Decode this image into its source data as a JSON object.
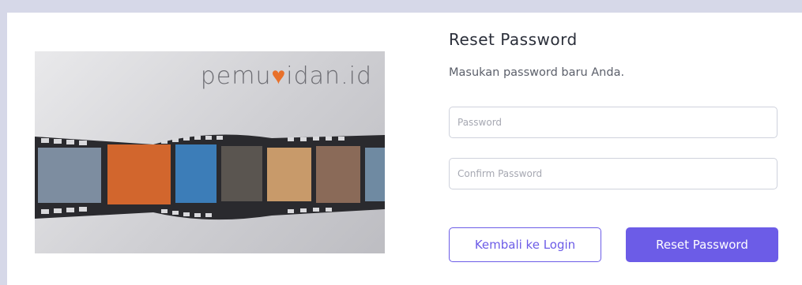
{
  "banner": {
    "logo_prefix": "pemu",
    "logo_heart": "♥",
    "logo_suffix": "idan.id"
  },
  "form": {
    "title": "Reset Password",
    "subtitle": "Masukan password baru Anda.",
    "password_placeholder": "Password",
    "confirm_placeholder": "Confirm Password",
    "back_label": "Kembali ke Login",
    "reset_label": "Reset Password"
  },
  "colors": {
    "accent": "#6c5ce7",
    "background": "#d6d8e8",
    "logo_accent": "#e8702a"
  }
}
